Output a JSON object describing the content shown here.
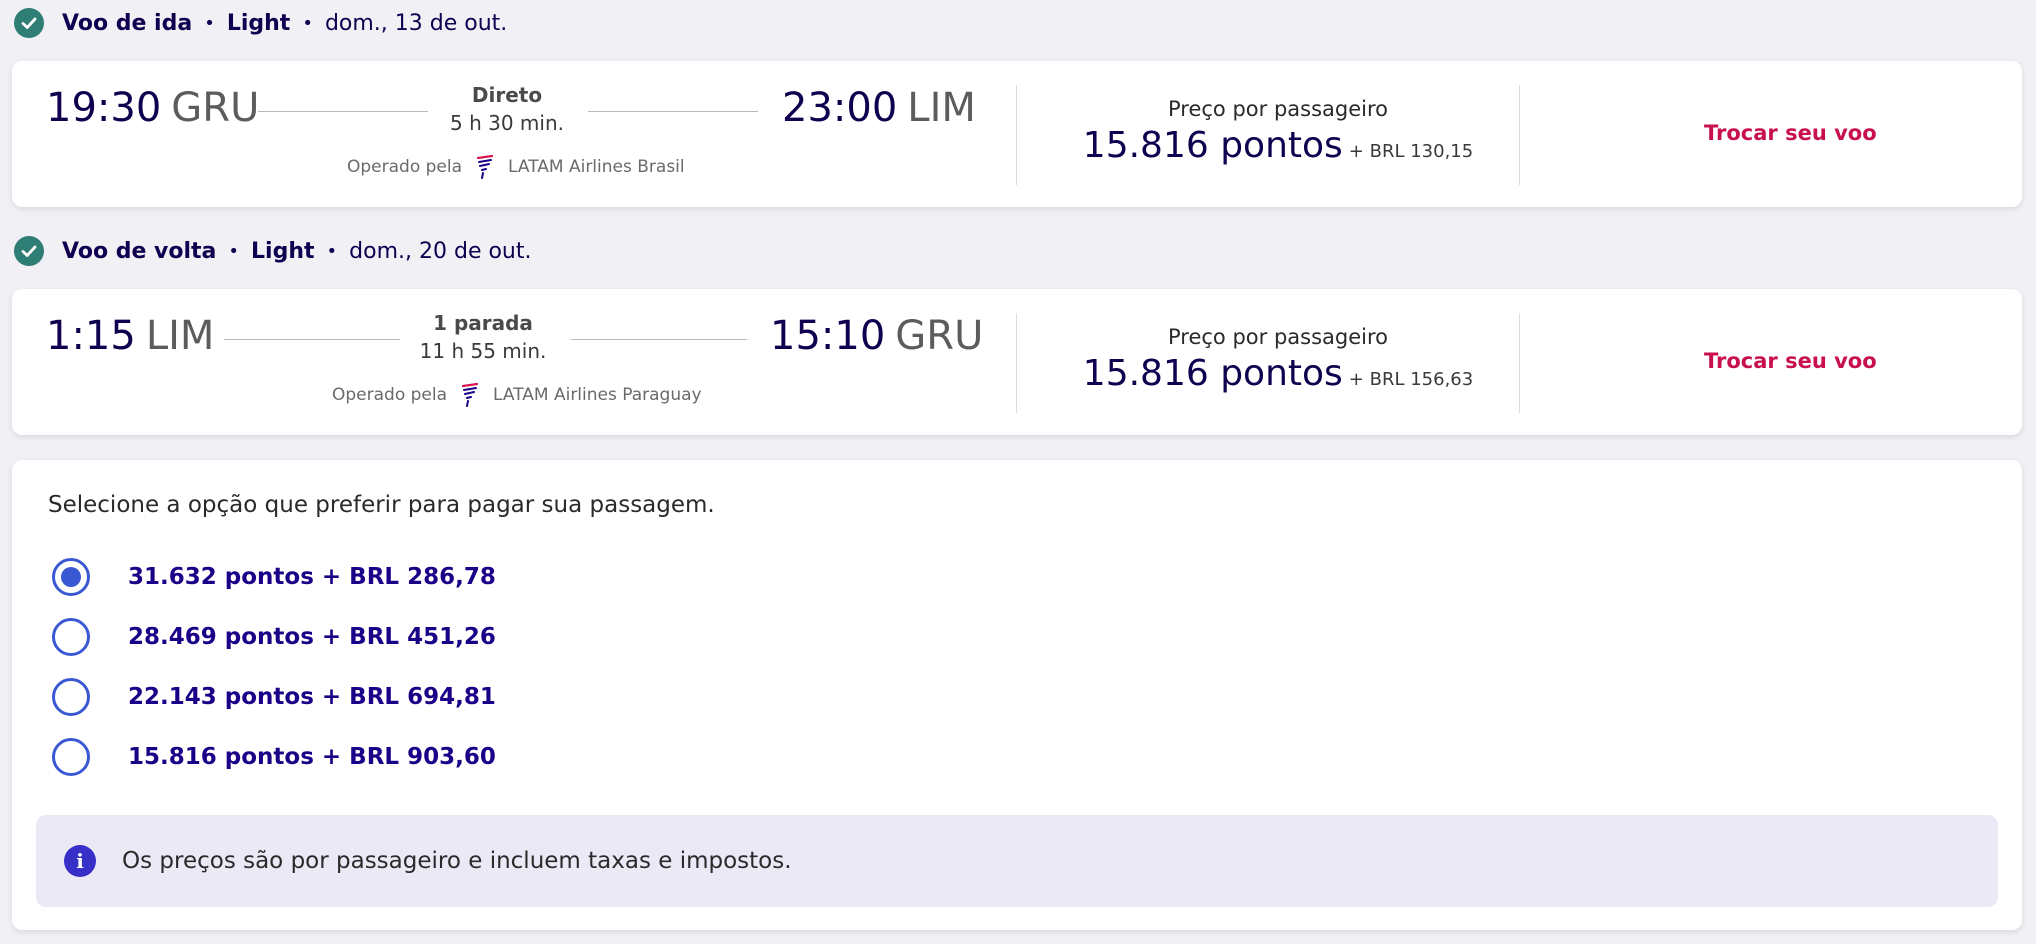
{
  "outbound": {
    "section": {
      "label": "Voo de ida",
      "fare": "Light",
      "date": "dom., 13 de out."
    },
    "depart_time": "19:30",
    "depart_code": "GRU",
    "stop_type": "Direto",
    "duration": "5 h 30 min.",
    "arrive_time": "23:00",
    "arrive_code": "LIM",
    "operated_label": "Operado pela",
    "operator": "LATAM Airlines Brasil",
    "price_label": "Preço por passageiro",
    "points": "15.816 pontos",
    "cash": "+ BRL 130,15",
    "swap_label": "Trocar seu voo"
  },
  "return": {
    "section": {
      "label": "Voo de volta",
      "fare": "Light",
      "date": "dom., 20 de out."
    },
    "depart_time": "1:15",
    "depart_code": "LIM",
    "stop_type": "1 parada",
    "duration": "11 h 55 min.",
    "arrive_time": "15:10",
    "arrive_code": "GRU",
    "operated_label": "Operado pela",
    "operator": "LATAM Airlines Paraguay",
    "price_label": "Preço por passageiro",
    "points": "15.816 pontos",
    "cash": "+ BRL 156,63",
    "swap_label": "Trocar seu voo"
  },
  "payment": {
    "title": "Selecione a opção que preferir para pagar sua passagem.",
    "options": [
      {
        "label": "31.632 pontos + BRL 286,78",
        "selected": true
      },
      {
        "label": "28.469 pontos + BRL 451,26",
        "selected": false
      },
      {
        "label": "22.143 pontos + BRL 694,81",
        "selected": false
      },
      {
        "label": "15.816 pontos + BRL 903,60",
        "selected": false
      }
    ],
    "info": "Os preços são por passageiro e incluem taxas e impostos."
  },
  "colors": {
    "accent": "#1b0088",
    "swap": "#c8104e",
    "check": "#2e7e76",
    "radio": "#3a57d4"
  },
  "icons": {
    "check": "check-circle-icon",
    "airline": "latam-logo-icon",
    "info": "info-icon"
  }
}
